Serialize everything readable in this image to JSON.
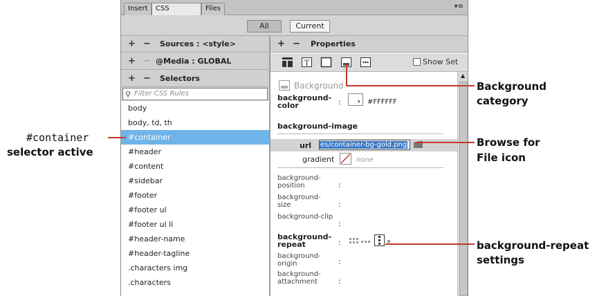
{
  "tabs": [
    "Insert",
    "CSS Designer",
    "Files"
  ],
  "panel_menu_icon": "≡",
  "toggle": {
    "all": "All",
    "current": "Current"
  },
  "left": {
    "sources": "Sources : <style>",
    "media": "@Media : GLOBAL",
    "selectors": "Selectors",
    "filter_placeholder": "Filter CSS Rules",
    "selector_items": [
      "body",
      "body, td, th",
      "#container",
      "#header",
      "#content",
      "#sidebar",
      "#footer",
      "#footer ul",
      "#footer ul li",
      "#header-name",
      "#header-tagline",
      ".characters img",
      ".characters"
    ],
    "active_index": 2
  },
  "right": {
    "properties": "Properties",
    "show_set": "Show Set",
    "background_label": "Background",
    "bg_color_l1": "background-",
    "bg_color_l2": "color",
    "bg_color_value": "#FFFFFF",
    "bg_image_title": "background-image",
    "url_label": "url",
    "url_value": "es/container-bg-gold.png",
    "gradient_label": "gradient",
    "gradient_value": "none",
    "pos_l1": "background-",
    "pos_l2": "position",
    "size_l1": "background-",
    "size_l2": "size",
    "clip": "background-clip",
    "repeat_l1": "background-",
    "repeat_l2": "repeat",
    "origin_l1": "background-",
    "origin_l2": "origin",
    "attach_l1": "background-",
    "attach_l2": "attachment"
  },
  "annotations": {
    "selector_l1": "#container",
    "selector_l2": "selector active",
    "category_l1": "Background",
    "category_l2": "category",
    "browse_l1": "Browse for",
    "browse_l2": "File icon",
    "repeat_l1": "background-repeat",
    "repeat_l2": "settings"
  },
  "colors": {
    "accent_line": "#c0392b",
    "selection": "#6fb4e9"
  }
}
